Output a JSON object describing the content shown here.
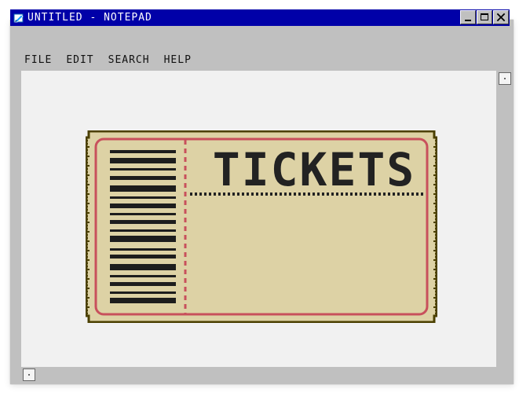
{
  "window": {
    "title": "UNTITLED - NOTEPAD"
  },
  "menu": {
    "items": [
      {
        "label": "FILE"
      },
      {
        "label": "EDIT"
      },
      {
        "label": "SEARCH"
      },
      {
        "label": "HELP"
      }
    ]
  },
  "ticket": {
    "title": "TICKETS"
  },
  "icons": {
    "app": "notepad-icon",
    "minimize": "minimize-icon",
    "maximize": "maximize-icon",
    "close": "close-icon",
    "scroll_up": "scroll-up-arrow-icon",
    "scroll_left": "scroll-left-arrow-icon",
    "ticket": "ticket-icon",
    "barcode": "barcode-icon"
  },
  "colors": {
    "titlebar": "#0000a8",
    "window_frame": "#c0c0c0",
    "content_background": "#f1f1f1",
    "ticket_fill": "#ddd2a5",
    "ticket_outline": "#4b4000",
    "ticket_inner_border": "#c8505c",
    "ticket_text": "#222222"
  }
}
